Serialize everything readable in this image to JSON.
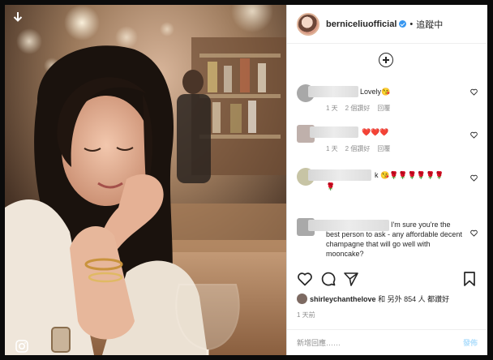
{
  "post": {
    "username": "berniceliuofficial",
    "follow_state": "追蹤中",
    "load_more_icon": "plus-circle-icon"
  },
  "comments": [
    {
      "text": "Lovely😘",
      "time": "1 天",
      "likes": "2 個讚好",
      "reply": "回覆"
    },
    {
      "text": "❤️❤️❤️",
      "time": "1 天",
      "likes": "2 個讚好",
      "reply": "回覆"
    },
    {
      "text": "k 😘🌹🌹🌹🌹🌹🌹",
      "text2": "🌹",
      "time": "",
      "likes": "",
      "reply": ""
    },
    {
      "text": "I'm sure you're the best person to ask - any affordable decent champagne that will go well with mooncake?",
      "time": "",
      "likes": "",
      "reply": ""
    }
  ],
  "likes": {
    "user": "shirleychanthelove",
    "rest": "和 另外 854 人 都讚好"
  },
  "time_ago": "1 天前",
  "add_comment": {
    "placeholder": "新增回應……",
    "post_label": "發佈"
  },
  "colors": {
    "verified": "#3897f0",
    "muted": "#8e8e8e",
    "text": "#262626",
    "post_disabled": "#b2dffc"
  }
}
